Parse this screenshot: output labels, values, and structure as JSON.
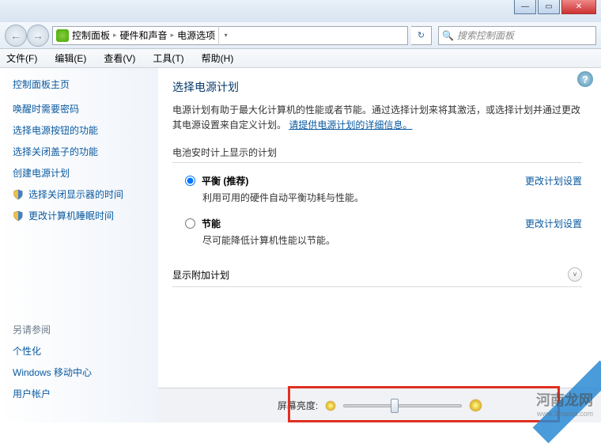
{
  "window": {
    "min": "—",
    "max": "▭",
    "close": "✕"
  },
  "nav": {
    "back": "←",
    "fwd": "→",
    "refresh": "↻"
  },
  "breadcrumb": {
    "root": "控制面板",
    "mid": "硬件和声音",
    "leaf": "电源选项",
    "sep": "▸"
  },
  "search": {
    "placeholder": "搜索控制面板",
    "icon": "🔍"
  },
  "menu": {
    "file": "文件(F)",
    "edit": "编辑(E)",
    "view": "查看(V)",
    "tools": "工具(T)",
    "help": "帮助(H)"
  },
  "sidebar": {
    "home": "控制面板主页",
    "tasks": [
      {
        "label": "唤醒时需要密码",
        "shield": false
      },
      {
        "label": "选择电源按钮的功能",
        "shield": false
      },
      {
        "label": "选择关闭盖子的功能",
        "shield": false
      },
      {
        "label": "创建电源计划",
        "shield": false
      },
      {
        "label": "选择关闭显示器的时间",
        "shield": true
      },
      {
        "label": "更改计算机睡眠时间",
        "shield": true
      }
    ],
    "seealso_hdr": "另请参阅",
    "seealso": [
      "个性化",
      "Windows 移动中心",
      "用户帐户"
    ]
  },
  "main": {
    "title": "选择电源计划",
    "desc_a": "电源计划有助于最大化计算机的性能或者节能。通过选择计划来将其激活，或选择计划并通过更改其电源设置来自定义计划。",
    "desc_link": "请提供电源计划的详细信息。",
    "section_battery": "电池安时计上显示的计划",
    "plans": [
      {
        "name": "平衡 (推荐)",
        "desc": "利用可用的硬件自动平衡功耗与性能。",
        "selected": true
      },
      {
        "name": "节能",
        "desc": "尽可能降低计算机性能以节能。",
        "selected": false
      }
    ],
    "change_settings": "更改计划设置",
    "additional": "显示附加计划",
    "expand": "˅"
  },
  "brightness": {
    "label": "屏幕亮度:",
    "value_pct": 40
  },
  "help_q": "?",
  "watermark": {
    "brand": "河南龙网",
    "url": "www.3mama.com"
  }
}
